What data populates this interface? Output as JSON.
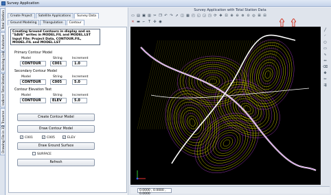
{
  "window": {
    "title": "Survey Application"
  },
  "side_tabs": [
    "Total Station",
    "Autolevel",
    "Bearing Line",
    "Indirect Total Station",
    "Traverse",
    "Drawing File in 3D"
  ],
  "top_tabs": [
    "Create Project",
    "Satellite Applications",
    "Survey Data"
  ],
  "sub_tabs": [
    "Ground Modeling",
    "Triangulation",
    "Contour"
  ],
  "description": "Creating Ground Contours in display and on \"SAVE\" writes in MODEL.FIL and MODEL.LST Input File: Project Data, CONTOUR.FIL, MODEL.FIL and MODEL.LST",
  "col_headers": {
    "model": "Model",
    "string": "String",
    "increment": "Increment"
  },
  "primary": {
    "title": "Primary Contour Model",
    "model": "CONTOUR",
    "string": "C001",
    "increment": "1.0"
  },
  "secondary": {
    "title": "Secondary Contour Model",
    "model": "CONTOUR",
    "string": "C005",
    "increment": "5.0"
  },
  "elevation": {
    "title": "Contour Elevation Text",
    "model": "CONTOUR",
    "string": "ELEV",
    "increment": "5.0"
  },
  "buttons": {
    "create_contour": "Create Contour Model",
    "draw_contour": "Draw Contour Model",
    "draw_ground": "Draw Ground Surface",
    "refresh": "Refresh"
  },
  "checkboxes": [
    {
      "label": "C001",
      "checked": true
    },
    {
      "label": "C005",
      "checked": true
    },
    {
      "label": "ELEV",
      "checked": true
    }
  ],
  "surface": {
    "label": "SURFACE",
    "checked": false
  },
  "graphics": {
    "title": "Survey Application with Total Station Data",
    "coords": "0.0000 , 0.0000 , 0.0000"
  },
  "colors": {
    "canvas_bg": "#000000",
    "contour_primary": "#e8e200",
    "contour_secondary": "#b13fd1",
    "road": "#ffffff",
    "annotation_arrow": "#d23a2a"
  }
}
